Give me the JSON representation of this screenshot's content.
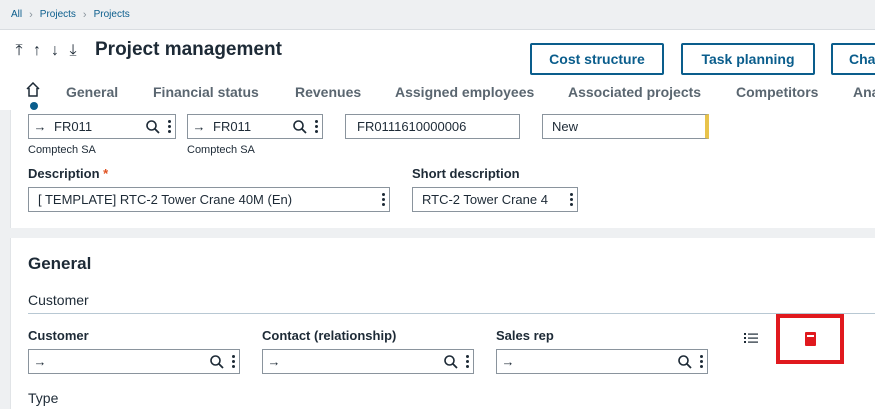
{
  "breadcrumb": [
    "All",
    "Projects",
    "Projects"
  ],
  "header": {
    "title": "Project management",
    "buttons": [
      "Cost structure",
      "Task planning",
      "Cha"
    ]
  },
  "tabs": [
    "General",
    "Financial status",
    "Revenues",
    "Assigned employees",
    "Associated projects",
    "Competitors",
    "Ana"
  ],
  "top": {
    "site1": "FR011",
    "site1_company": "Comptech SA",
    "site2": "FR011",
    "site2_company": "Comptech SA",
    "project_number": "FR0111610000006",
    "status": "New",
    "description_label": "Description",
    "description": "[ TEMPLATE] RTC-2 Tower Crane 40M (En)",
    "short_description_label": "Short description",
    "short_description": "RTC-2 Tower Crane 4"
  },
  "general": {
    "title": "General",
    "customer_block": "Customer",
    "fields": {
      "customer_label": "Customer",
      "contact_label": "Contact (relationship)",
      "salesrep_label": "Sales rep"
    },
    "type_label": "Type"
  },
  "icons": {
    "red_box_color": "#e0191e",
    "accent": "#0a5d8c"
  }
}
